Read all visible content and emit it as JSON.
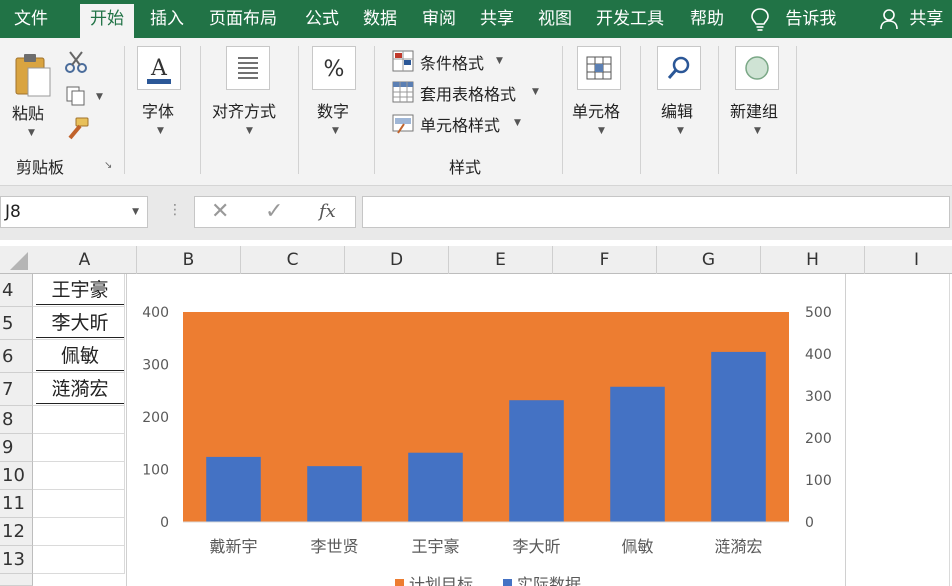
{
  "menu": {
    "tabs": [
      "文件",
      "开始",
      "插入",
      "页面布局",
      "公式",
      "数据",
      "审阅",
      "共享",
      "视图",
      "开发工具",
      "帮助"
    ],
    "tell_me": "告诉我",
    "share": "共享"
  },
  "ribbon": {
    "paste": "粘贴",
    "clipboard": "剪贴板",
    "font": "字体",
    "alignment": "对齐方式",
    "number": "数字",
    "conditional_format": "条件格式",
    "table_format": "套用表格格式",
    "cell_style": "单元格样式",
    "styles": "样式",
    "cells": "单元格",
    "editing": "编辑",
    "new_group": "新建组"
  },
  "formula_bar": {
    "name_box": "J8",
    "fx": "fx",
    "formula": ""
  },
  "sheet": {
    "columns": [
      "A",
      "B",
      "C",
      "D",
      "E",
      "F",
      "G",
      "H",
      "I"
    ],
    "rows": [
      "4",
      "5",
      "6",
      "7",
      "8",
      "9",
      "10",
      "11",
      "12",
      "13"
    ],
    "names": [
      "王宇豪",
      "李大昕",
      "佩敏",
      "涟漪宏"
    ]
  },
  "chart_data": {
    "type": "bar",
    "categories": [
      "戴新宇",
      "李世贤",
      "王宇豪",
      "李大昕",
      "佩敏",
      "涟漪宏"
    ],
    "series": [
      {
        "name": "计划目标",
        "values": [
          400,
          400,
          400,
          400,
          400,
          400
        ],
        "axis": "left",
        "color": "#ED7D31",
        "style": "area"
      },
      {
        "name": "实际数据",
        "values": [
          155,
          133,
          165,
          290,
          322,
          405
        ],
        "axis": "right",
        "color": "#4472C4",
        "style": "bar"
      }
    ],
    "y_left": {
      "min": 0,
      "max": 400,
      "ticks": [
        0,
        100,
        200,
        300,
        400
      ]
    },
    "y_right": {
      "min": 0,
      "max": 500,
      "ticks": [
        0,
        100,
        200,
        300,
        400,
        500
      ]
    },
    "grid": false,
    "legend": "bottom"
  },
  "colors": {
    "brand": "#217346"
  }
}
